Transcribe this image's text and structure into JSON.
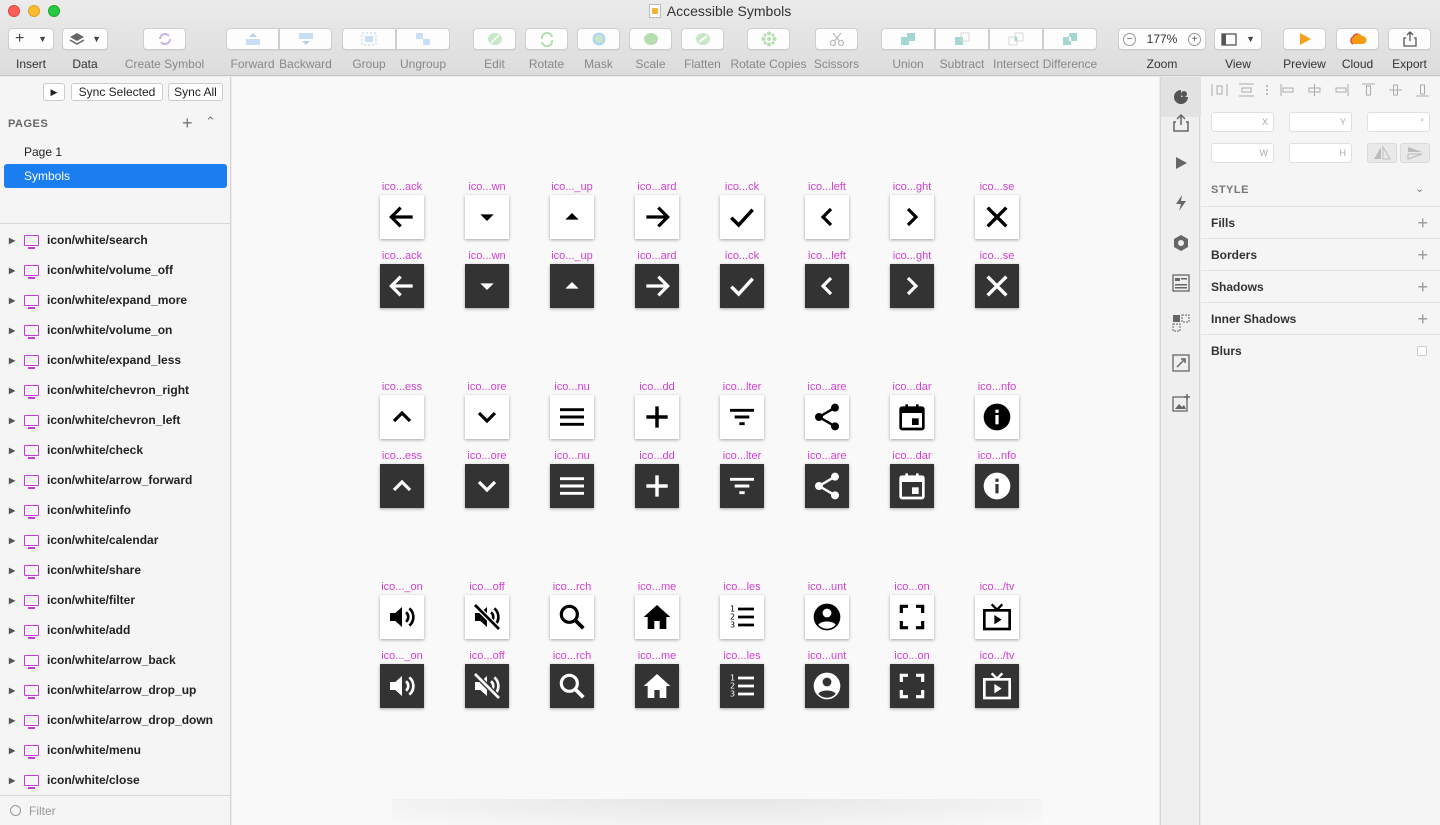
{
  "window": {
    "title": "Accessible Symbols"
  },
  "toolbar": {
    "insert": "Insert",
    "data": "Data",
    "create_symbol": "Create Symbol",
    "forward": "Forward",
    "backward": "Backward",
    "group": "Group",
    "ungroup": "Ungroup",
    "edit": "Edit",
    "rotate": "Rotate",
    "mask": "Mask",
    "scale": "Scale",
    "flatten": "Flatten",
    "rotate_copies": "Rotate Copies",
    "scissors": "Scissors",
    "union": "Union",
    "subtract": "Subtract",
    "intersect": "Intersect",
    "difference": "Difference",
    "zoom_label": "Zoom",
    "zoom_value": "177%",
    "zoom_minus": "−",
    "zoom_plus": "+",
    "view": "View",
    "preview": "Preview",
    "cloud": "Cloud",
    "export": "Export"
  },
  "sidebar": {
    "sync_selected": "Sync Selected",
    "sync_all": "Sync All",
    "pages_header": "PAGES",
    "pages": [
      "Page 1",
      "Symbols"
    ],
    "selected_page": "Symbols",
    "layers": [
      "icon/white/search",
      "icon/white/volume_off",
      "icon/white/expand_more",
      "icon/white/volume_on",
      "icon/white/expand_less",
      "icon/white/chevron_right",
      "icon/white/chevron_left",
      "icon/white/check",
      "icon/white/arrow_forward",
      "icon/white/info",
      "icon/white/calendar",
      "icon/white/share",
      "icon/white/filter",
      "icon/white/add",
      "icon/white/arrow_back",
      "icon/white/arrow_drop_up",
      "icon/white/arrow_drop_down",
      "icon/white/menu",
      "icon/white/close"
    ],
    "filter_placeholder": "Filter"
  },
  "canvas": {
    "groups": [
      {
        "labels": [
          "ico...ack",
          "ico...wn",
          "ico..._up",
          "ico...ard",
          "ico...ck",
          "ico...left",
          "ico...ght",
          "ico...se"
        ],
        "icons": [
          "arrow-back-icon",
          "arrow-drop-down-icon",
          "arrow-drop-up-icon",
          "arrow-forward-icon",
          "check-icon",
          "chevron-left-icon",
          "chevron-right-icon",
          "close-icon"
        ]
      },
      {
        "labels": [
          "ico...ess",
          "ico...ore",
          "ico...nu",
          "ico...dd",
          "ico...lter",
          "ico...are",
          "ico...dar",
          "ico...nfo"
        ],
        "icons": [
          "expand-less-icon",
          "expand-more-icon",
          "menu-icon",
          "add-icon",
          "filter-icon",
          "share-icon",
          "calendar-icon",
          "info-icon"
        ]
      },
      {
        "labels": [
          "ico..._on",
          "ico...off",
          "ico...rch",
          "ico...me",
          "ico...les",
          "ico...unt",
          "ico...on",
          "ico.../tv"
        ],
        "icons": [
          "volume-on-icon",
          "volume-off-icon",
          "search-icon",
          "home-icon",
          "list-icon",
          "account-icon",
          "fullscreen-icon",
          "tv-icon"
        ]
      }
    ]
  },
  "inspector": {
    "x_label": "X",
    "y_label": "Y",
    "rotation_label": "°",
    "w_label": "W",
    "h_label": "H",
    "style_header": "STYLE",
    "sections": [
      "Fills",
      "Borders",
      "Shadows",
      "Inner Shadows",
      "Blurs"
    ]
  },
  "colors": {
    "accent": "#1a7df0",
    "symbol_label": "#d23fd2",
    "dark_tile": "#333333"
  }
}
